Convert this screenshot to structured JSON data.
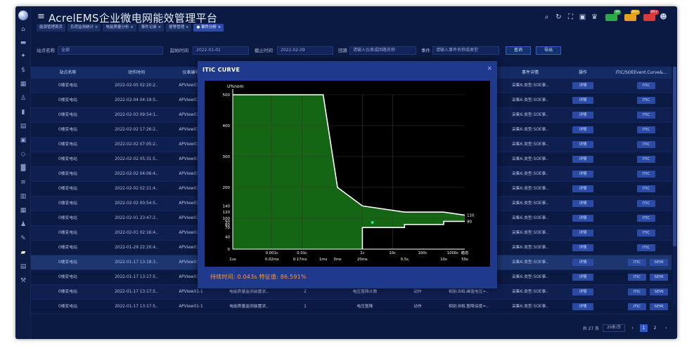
{
  "app": {
    "title": "AcrelEMS企业微电网能效管理平台"
  },
  "tabs": [
    {
      "label": "能源管理首页",
      "active": false
    },
    {
      "label": "负荷监测统计 ×",
      "active": false
    },
    {
      "label": "电能质量分析 ×",
      "active": false
    },
    {
      "label": "事件记录 ×",
      "active": false
    },
    {
      "label": "报警管理 ×",
      "active": false
    },
    {
      "label": "● 事件分析 ×",
      "active": true
    }
  ],
  "topbar": {
    "icons": [
      "search-icon",
      "refresh-icon",
      "fullscreen-icon",
      "screenshot-icon",
      "shirt-icon"
    ],
    "chips": [
      {
        "label": "预警",
        "count": "99",
        "color": "#2ea84a",
        "count_color": "#2ea84a"
      },
      {
        "label": "告警",
        "count": "99+",
        "color": "#e6a21a",
        "count_color": "#e6a21a"
      },
      {
        "label": "事故",
        "count": "99+",
        "color": "#d83a3a",
        "count_color": "#d83a3a"
      }
    ],
    "user_icon": "user-icon"
  },
  "filter": {
    "station_label": "站点名称",
    "station_value": "全部",
    "start_label": "起始时间",
    "start_value": "2022-01-01",
    "end_label": "截止时间",
    "end_value": "2022-02-09",
    "loop_label": "回路",
    "loop_placeholder": "请输入仪表或回路名称",
    "event_label": "事件",
    "event_placeholder": "请输入事件名称或类型",
    "query_label": "查询",
    "export_label": "导出"
  },
  "table": {
    "headers": [
      "站点名称",
      "动作时间",
      "仪表编号",
      "",
      "",
      "",
      "",
      "",
      "事件详情",
      "操作",
      "ITIC/SOEEvent.Curve&..."
    ],
    "rows": [
      {
        "site": "0楼变电站",
        "time": "2022-02-05 02:20:2..",
        "device": "APView01-1",
        "c4": "",
        "c5": "",
        "c6": "",
        "c7": "",
        "c8": "",
        "detail": "采集6.类型:SOE事..",
        "op": "详情",
        "act": "ITIC",
        "semi": ""
      },
      {
        "site": "0楼变电站",
        "time": "2022-02-04 04:19:5..",
        "device": "APView01-1",
        "c4": "",
        "c5": "",
        "c6": "",
        "c7": "",
        "c8": "",
        "detail": "采集6.类型:SOE事..",
        "op": "详情",
        "act": "ITIC",
        "semi": ""
      },
      {
        "site": "0楼变电站",
        "time": "2022-02-03 09:54:1..",
        "device": "APView01-1",
        "c4": "",
        "c5": "",
        "c6": "",
        "c7": "",
        "c8": "",
        "detail": "采集6.类型:SOE事..",
        "op": "详情",
        "act": "ITIC",
        "semi": ""
      },
      {
        "site": "0楼变电站",
        "time": "2022-02-02 17:26:2..",
        "device": "APView01-1",
        "c4": "",
        "c5": "",
        "c6": "",
        "c7": "",
        "c8": "",
        "detail": "采集6.类型:SOE事..",
        "op": "详情",
        "act": "ITIC",
        "semi": ""
      },
      {
        "site": "0楼变电站",
        "time": "2022-02-02 07:05:2..",
        "device": "APView01-1",
        "c4": "",
        "c5": "",
        "c6": "",
        "c7": "",
        "c8": "",
        "detail": "采集6.类型:SOE事..",
        "op": "详情",
        "act": "ITIC",
        "semi": ""
      },
      {
        "site": "0楼变电站",
        "time": "2022-02-02 05:31:5..",
        "device": "APView01-1",
        "c4": "",
        "c5": "",
        "c6": "",
        "c7": "",
        "c8": "",
        "detail": "采集6.类型:SOE事..",
        "op": "详情",
        "act": "ITIC",
        "semi": ""
      },
      {
        "site": "0楼变电站",
        "time": "2022-02-02 04:06:4..",
        "device": "APView01-1",
        "c4": "",
        "c5": "",
        "c6": "",
        "c7": "",
        "c8": "",
        "detail": "采集6.类型:SOE事..",
        "op": "详情",
        "act": "ITIC",
        "semi": ""
      },
      {
        "site": "0楼变电站",
        "time": "2022-02-02 02:21:4..",
        "device": "APView01-1",
        "c4": "",
        "c5": "",
        "c6": "",
        "c7": "",
        "c8": "",
        "detail": "采集6.类型:SOE事..",
        "op": "详情",
        "act": "ITIC",
        "semi": ""
      },
      {
        "site": "0楼变电站",
        "time": "2022-02-02 00:54:5..",
        "device": "APView01-1",
        "c4": "",
        "c5": "",
        "c6": "",
        "c7": "",
        "c8": "",
        "detail": "采集6.类型:SOE事..",
        "op": "详情",
        "act": "ITIC",
        "semi": ""
      },
      {
        "site": "0楼变电站",
        "time": "2022-02-01 23:47:2..",
        "device": "APView01-1",
        "c4": "",
        "c5": "",
        "c6": "",
        "c7": "",
        "c8": "",
        "detail": "采集6.类型:SOE事..",
        "op": "详情",
        "act": "ITIC",
        "semi": ""
      },
      {
        "site": "0楼变电站",
        "time": "2022-02-01 02:16:4..",
        "device": "APView01-1",
        "c4": "",
        "c5": "",
        "c6": "",
        "c7": "",
        "c8": "",
        "detail": "采集6.类型:SOE事..",
        "op": "详情",
        "act": "ITIC",
        "semi": ""
      },
      {
        "site": "0楼变电站",
        "time": "2022-01-29 22:20:4..",
        "device": "APView01-1",
        "c4": "",
        "c5": "",
        "c6": "",
        "c7": "",
        "c8": "",
        "detail": "采集6.类型:SOE事..",
        "op": "详情",
        "act": "ITIC",
        "semi": ""
      },
      {
        "site": "0楼变电站",
        "time": "2022-01-17 13:18:3..",
        "device": "APView01-1",
        "c4": "",
        "c5": "",
        "c6": "",
        "c7": "",
        "c8": "",
        "detail": "采集6.类型:SOE事..",
        "op": "详情",
        "act": "ITIC",
        "semi": "SEMI",
        "highlight": true
      },
      {
        "site": "0楼变电站",
        "time": "2022-01-17 13:17:5..",
        "device": "APView01-1",
        "c4": "",
        "c5": "",
        "c6": "",
        "c7": "",
        "c8": "",
        "detail": "采集6.类型:SOE事..",
        "op": "详情",
        "act": "ITIC",
        "semi": "SEMI"
      },
      {
        "site": "0楼变电站",
        "time": "2022-01-17 13:17:5..",
        "device": "APView01-1",
        "c4": "电能质量监测装置状..",
        "c5": "2",
        "c6": "电压暂降计数",
        "c7": "动作",
        "c8": "相别:B相,峰值电压=..",
        "detail": "采集6.类型:SOE事..",
        "op": "详情",
        "act": "ITIC",
        "semi": "SEMI"
      },
      {
        "site": "0楼变电站",
        "time": "2022-01-17 13:17:5..",
        "device": "APView01-1",
        "c4": "电能质量监测装置状..",
        "c5": "1",
        "c6": "电压暂降",
        "c7": "动作",
        "c8": "相别:B相,暂降深度=..",
        "detail": "采集6.类型:SOE事..",
        "op": "详情",
        "act": "ITIC",
        "semi": "SEMI"
      }
    ]
  },
  "pager": {
    "total": "共 27 条",
    "page_size": "20条/页",
    "pages": [
      "1",
      "2"
    ],
    "current": "1",
    "prev": "‹",
    "next": "›"
  },
  "modal": {
    "title": "ITIC CURVE",
    "close": "×",
    "duration_label": "持续时间",
    "duration_value": "0.043s",
    "feature_label": "特征值",
    "feature_value": "86.591%"
  },
  "chart_data": {
    "type": "area",
    "title": "",
    "ylabel": "U%nom",
    "ylim": [
      0,
      500
    ],
    "x_scale": "log",
    "y_ticks": [
      "0",
      "40",
      "70",
      "80",
      "90",
      "100",
      "120",
      "140",
      "200",
      "300",
      "400",
      "500"
    ],
    "x_top_ticks": [
      "0.001c",
      "0.01c",
      "1c",
      "10c",
      "100c",
      "1000c",
      "稳态"
    ],
    "x_bottom_ticks": [
      "1us",
      "0.02ms",
      "0.17ms",
      "1ms",
      "3ms",
      "20ms",
      "0.5s",
      "10s",
      "50s"
    ],
    "right_labels": [
      "110",
      "90"
    ],
    "event_point": {
      "duration": "0.043s",
      "value": 86.591
    },
    "curve_color": "#ffffff",
    "fill_color": "#156a15"
  }
}
